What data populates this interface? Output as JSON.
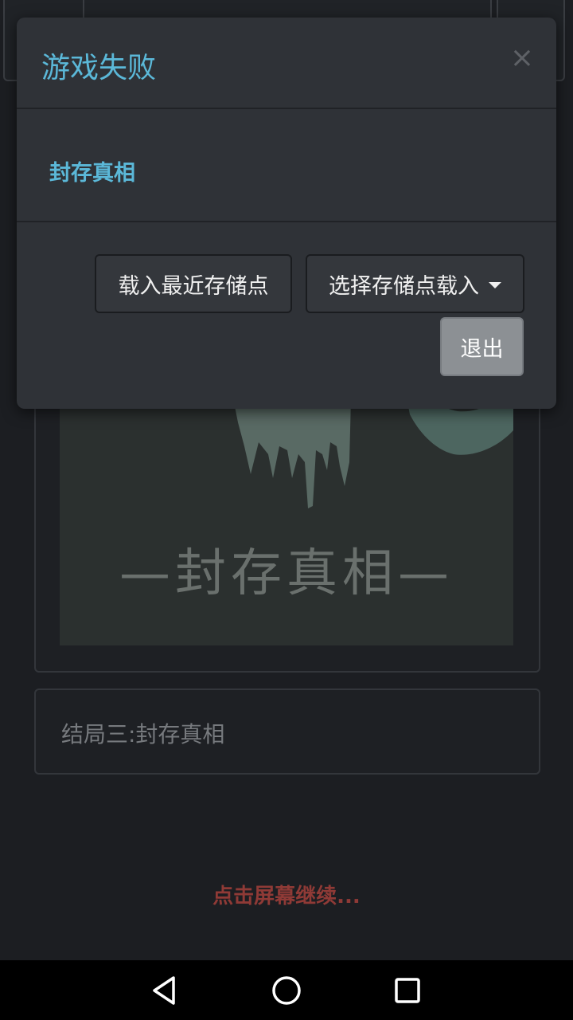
{
  "background": {
    "art_title": "—封存真相—",
    "ending_label": "结局三:封存真相",
    "continue_hint": "点击屏幕继续..."
  },
  "modal": {
    "title": "游戏失败",
    "close_symbol": "×",
    "body_text": "封存真相",
    "load_latest_label": "载入最近存储点",
    "select_save_label": "选择存储点载入",
    "exit_label": "退出"
  },
  "navbar": {
    "icons": [
      "back-icon",
      "home-icon",
      "recents-icon"
    ]
  },
  "colors": {
    "accent": "#5bb8d8",
    "continue": "#8f3a36",
    "modal_bg": "#2f3237",
    "page_bg": "#1c1e22"
  }
}
